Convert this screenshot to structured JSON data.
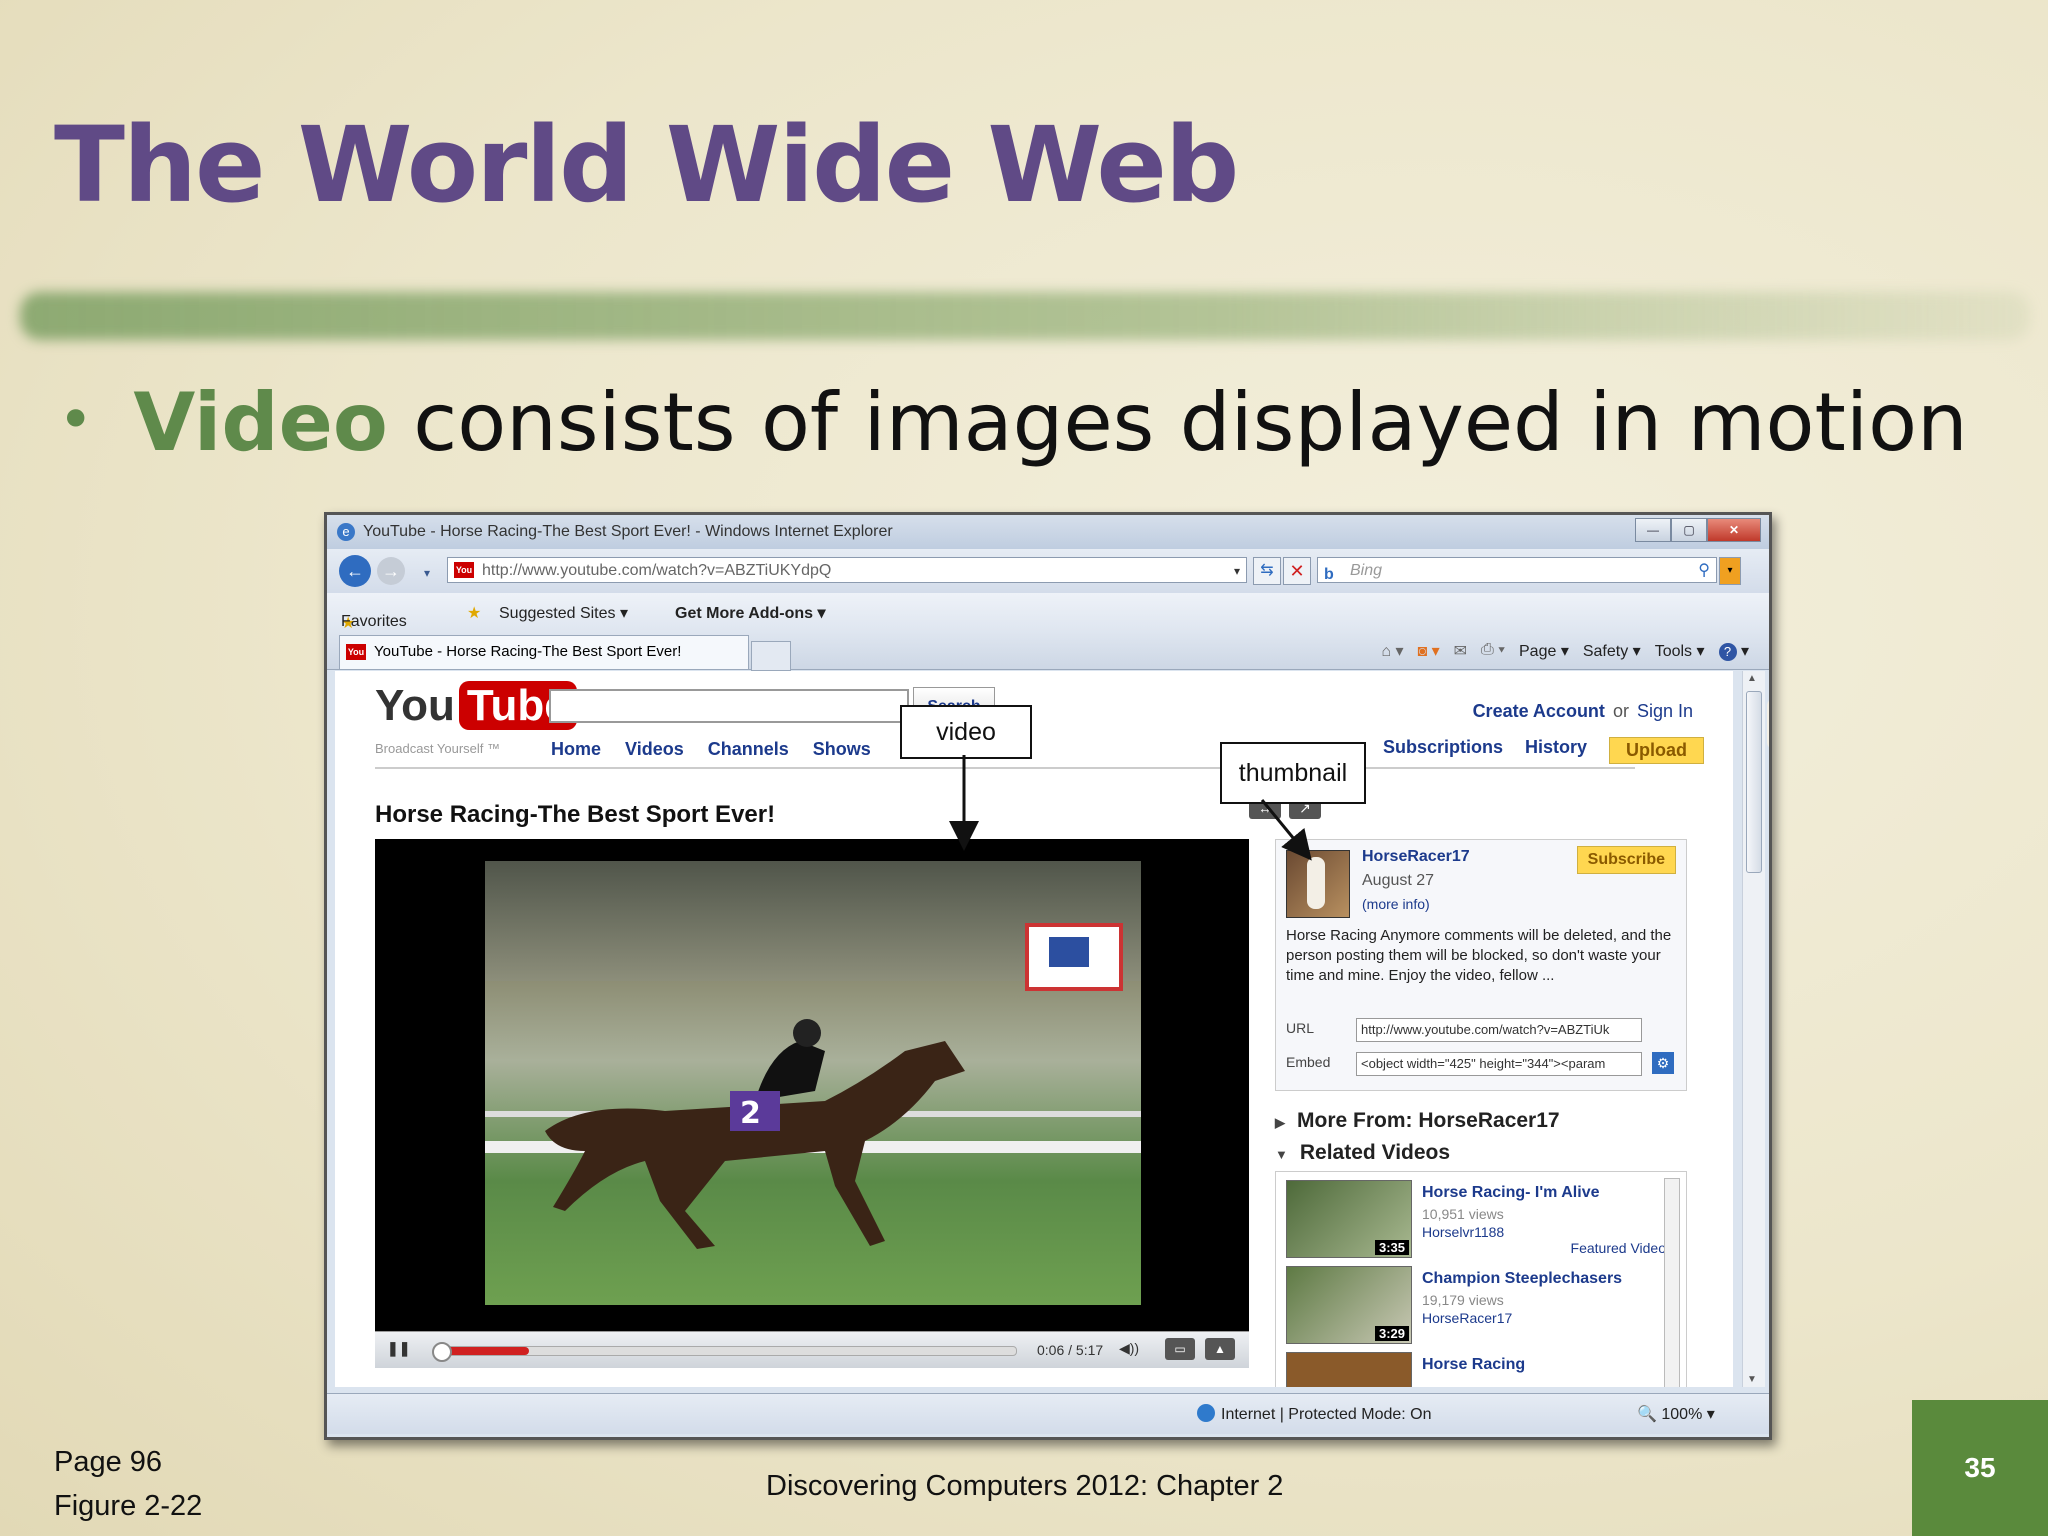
{
  "slide": {
    "title": "The World Wide Web",
    "bullet_keyword": "Video",
    "bullet_rest": " consists of images displayed in motion",
    "page_ref": "Page 96",
    "figure_ref": "Figure 2-22",
    "footer": "Discovering Computers 2012: Chapter 2",
    "slide_number": "35"
  },
  "browser": {
    "window_title": "YouTube - Horse Racing-The Best Sport Ever! - Windows Internet Explorer",
    "address": "http://www.youtube.com/watch?v=ABZTiUKYdpQ",
    "search_placeholder": "Bing",
    "favorites": "Favorites",
    "suggested_sites": "Suggested Sites ▾",
    "addons": "Get More Add-ons ▾",
    "tab_title": "YouTube - Horse Racing-The Best Sport Ever!",
    "cmd_page": "Page ▾",
    "cmd_safety": "Safety ▾",
    "cmd_tools": "Tools ▾",
    "status_zone": "Internet | Protected Mode: On",
    "zoom": "100%"
  },
  "youtube": {
    "logo_you": "You",
    "logo_tube": "Tube",
    "tagline": "Broadcast Yourself ™",
    "search_button": "Search",
    "nav": [
      "Home",
      "Videos",
      "Channels",
      "Shows"
    ],
    "create_account": "Create Account",
    "or": "or",
    "sign_in": "Sign In",
    "nav_right": [
      "Subscriptions",
      "History"
    ],
    "upload": "Upload",
    "video_title": "Horse Racing-The Best Sport Ever!",
    "time": "0:06 / 5:17",
    "channel": "HorseRacer17",
    "date": "August 27",
    "more_info": "(more info)",
    "subscribe": "Subscribe",
    "description": "Horse Racing Anymore comments will be deleted, and the person posting them will be blocked, so don't waste your time and mine. Enjoy the video, fellow ...",
    "url_label": "URL",
    "url_value": "http://www.youtube.com/watch?v=ABZTiUk",
    "embed_label": "Embed",
    "embed_value": "<object width=\"425\" height=\"344\"><param",
    "more_from": "More From: HorseRacer17",
    "related_header": "Related Videos",
    "related": [
      {
        "title": "Horse Racing- I'm Alive",
        "views": "10,951 views",
        "user": "Horselvr1188",
        "duration": "3:35",
        "tag": "Featured Video"
      },
      {
        "title": "Champion Steeplechasers",
        "views": "19,179 views",
        "user": "HorseRacer17",
        "duration": "3:29"
      },
      {
        "title": "Horse Racing"
      }
    ]
  },
  "callouts": {
    "video": "video",
    "thumbnail": "thumbnail"
  }
}
